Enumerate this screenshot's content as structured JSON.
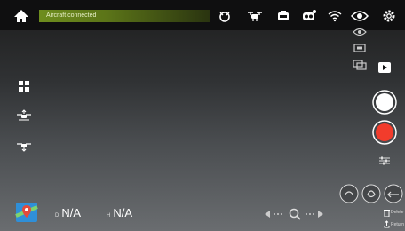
{
  "status": {
    "text": "Aircraft connected",
    "color": "#5b7418"
  },
  "top_icons": [
    "home-icon",
    "remote-controller-icon",
    "drone-icon",
    "battery-icon",
    "camera-icon",
    "wifi-icon",
    "eye-icon",
    "settings-icon"
  ],
  "view_menu": [
    "eye-icon",
    "overlay-icon",
    "camera-switch-icon"
  ],
  "left_icons": [
    "grid-icon",
    "takeoff-icon",
    "landing-icon"
  ],
  "readouts": {
    "distance": {
      "prefix": "D",
      "value": "N/A"
    },
    "height": {
      "prefix": "H",
      "value": "N/A"
    }
  },
  "colors": {
    "shutter": "#ffffff",
    "record": "#f23c2c"
  },
  "right_bottom": {
    "delete_label": "Delete",
    "return_label": "Return"
  }
}
